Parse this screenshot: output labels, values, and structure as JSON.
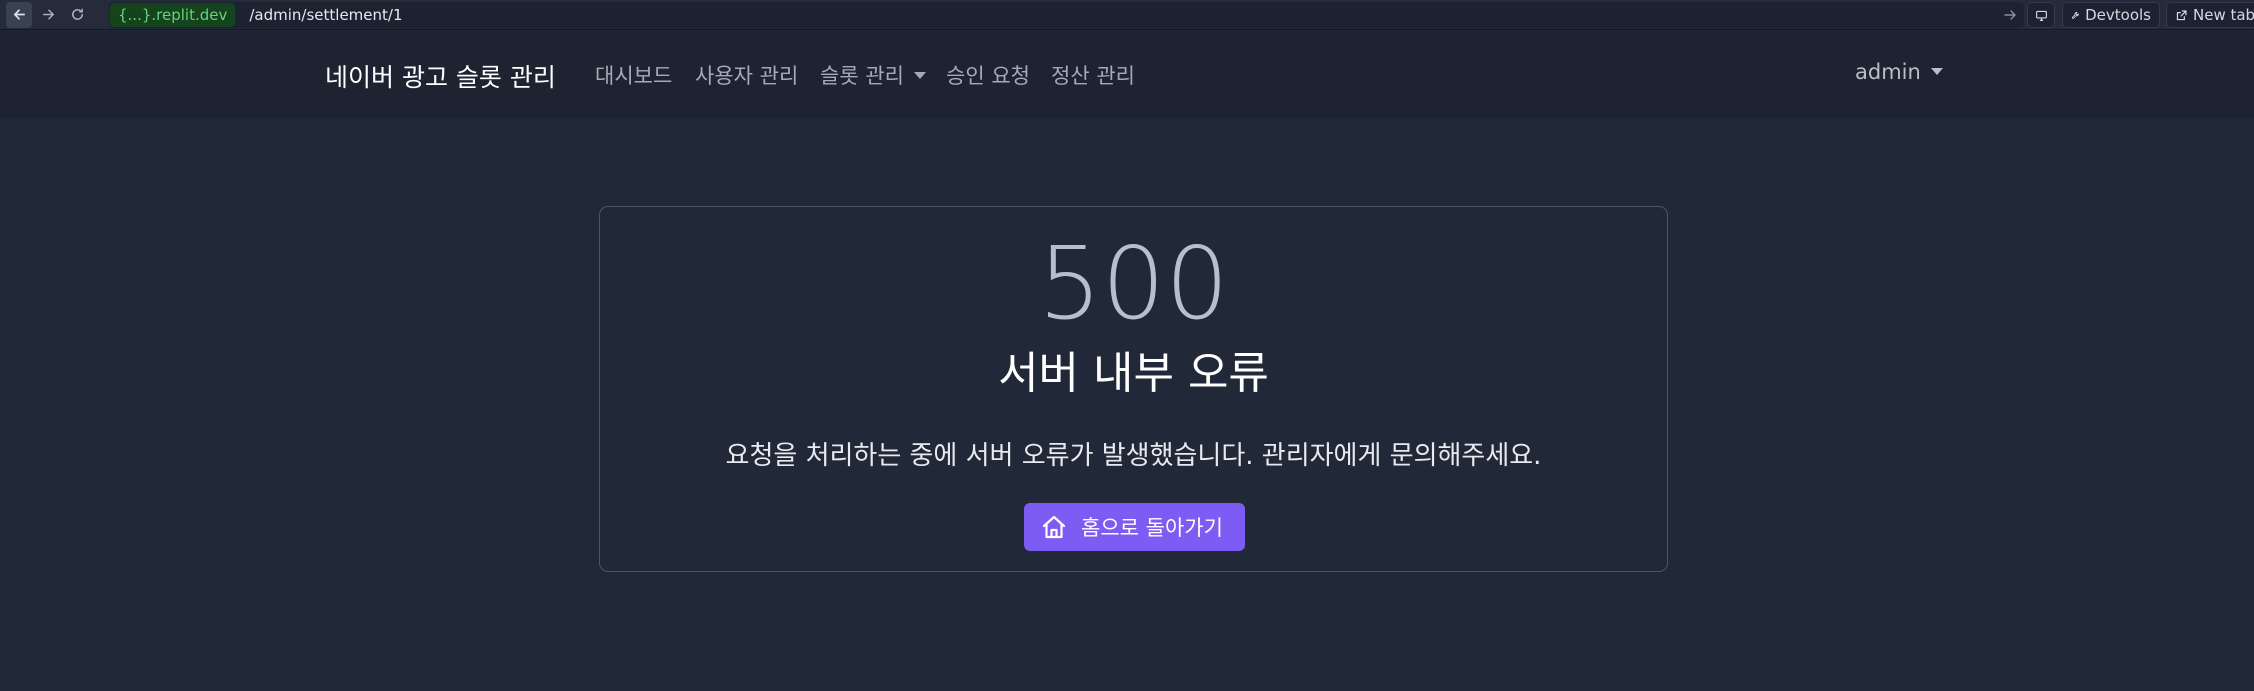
{
  "browser": {
    "domain": "{...}.replit.dev",
    "path": "/admin/settlement/1",
    "devtools_label": "Devtools",
    "new_tab_label": "New tab"
  },
  "navbar": {
    "brand": "네이버 광고 슬롯 관리",
    "links": [
      {
        "label": "대시보드"
      },
      {
        "label": "사용자 관리"
      },
      {
        "label": "슬롯 관리"
      },
      {
        "label": "승인 요청"
      },
      {
        "label": "정산 관리"
      }
    ],
    "user": "admin"
  },
  "error": {
    "code": "500",
    "title": "서버 내부 오류",
    "message": "요청을 처리하는 중에 서버 오류가 발생했습니다. 관리자에게 문의해주세요.",
    "home_button": "홈으로 돌아가기"
  },
  "colors": {
    "background": "#212837",
    "navbar": "#1d2331",
    "accent": "#7c5cf2",
    "domain_pill": "#14431e",
    "domain_text": "#67d37a"
  },
  "icons": {
    "back": "arrow-left-icon",
    "forward": "arrow-right-icon",
    "reload": "reload-icon",
    "go": "arrow-right-icon",
    "screen": "monitor-icon",
    "devtools": "wrench-icon",
    "new_tab": "external-link-icon",
    "home": "home-icon",
    "dropdown": "caret-down-icon"
  }
}
